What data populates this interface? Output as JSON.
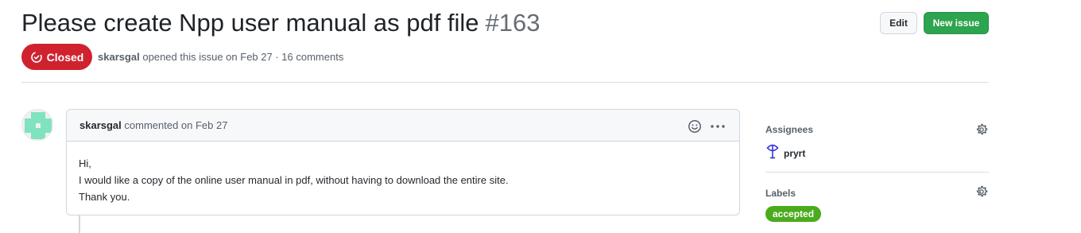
{
  "issue": {
    "title": "Please create Npp user manual as pdf file",
    "number": "#163",
    "state": "Closed",
    "author": "skarsgal",
    "opened_text": "opened this issue on Feb 27 · 16 comments"
  },
  "header_actions": {
    "edit_label": "Edit",
    "new_issue_label": "New issue"
  },
  "comment": {
    "author": "skarsgal",
    "commented_text": "commented on Feb 27",
    "body_lines": [
      "Hi,",
      "I would like a copy of the online user manual in pdf, without having to download the entire site.",
      "Thank you."
    ]
  },
  "sidebar": {
    "assignees_heading": "Assignees",
    "assignee_name": "pryrt",
    "labels_heading": "Labels",
    "label_name": "accepted"
  },
  "colors": {
    "closed_badge": "#cf222e",
    "new_issue_button": "#2da44e",
    "label_accepted": "#4bab1c",
    "avatar_pattern": "#7fe3bf"
  },
  "icons": {
    "closed_state": "issue-closed-icon",
    "emoji": "smiley-icon",
    "more": "kebab-horizontal-icon",
    "settings": "gear-icon",
    "assignee_avatar": "assignee-avatar-icon"
  }
}
